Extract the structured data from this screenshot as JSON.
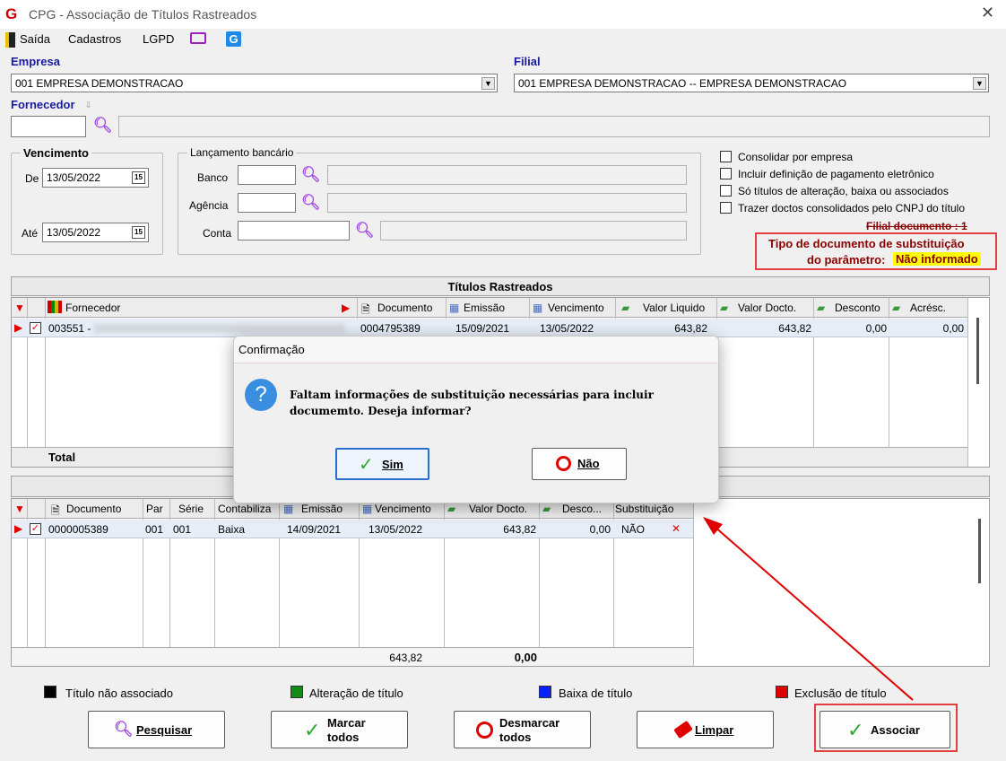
{
  "window": {
    "title": "CPG - Associação de Títulos Rastreados"
  },
  "menu": [
    "Saída",
    "Cadastros",
    "LGPD"
  ],
  "empresa": {
    "label": "Empresa",
    "value": "001 EMPRESA DEMONSTRACAO"
  },
  "filial": {
    "label": "Filial",
    "value": "001 EMPRESA DEMONSTRACAO -- EMPRESA DEMONSTRACAO"
  },
  "fornecedor": {
    "label": "Fornecedor"
  },
  "vencimento": {
    "label": "Vencimento",
    "de_label": "De",
    "de": "13/05/2022",
    "ate_label": "Até",
    "ate": "13/05/2022"
  },
  "lancamento": {
    "label": "Lançamento bancário",
    "banco": "Banco",
    "agencia": "Agência",
    "conta": "Conta"
  },
  "options": [
    "Consolidar por empresa",
    "Incluir definição de pagamento eletrônico",
    "Só títulos de alteração, baixa ou associados",
    "Trazer doctos consolidados pelo CNPJ do título"
  ],
  "info": {
    "filial_doc": "Filial documento : 1",
    "tipo_line1": "Tipo de documento de substituição",
    "tipo_line2": "do parâmetro:",
    "tipo_value": "Não informado"
  },
  "grid1": {
    "title": "Títulos Rastreados",
    "cols": [
      "Fornecedor",
      "Documento",
      "Emissão",
      "Vencimento",
      "Valor Liquido",
      "Valor Docto.",
      "Desconto",
      "Acrésc."
    ],
    "row": {
      "fornecedor": "003551 -",
      "documento": "0004795389",
      "emissao": "15/09/2021",
      "vencimento": "13/05/2022",
      "liquido": "643,82",
      "docto": "643,82",
      "desconto": "0,00",
      "acresc": "0,00"
    },
    "total": "Total"
  },
  "grid2": {
    "cols": [
      "Documento",
      "Par",
      "Série",
      "Contabiliza",
      "Emissão",
      "Vencimento",
      "Valor Docto.",
      "Desco...",
      "Substituição"
    ],
    "row": {
      "documento": "0000005389",
      "par": "001",
      "serie": "001",
      "contabiliza": "Baixa",
      "emissao": "14/09/2021",
      "vencimento": "13/05/2022",
      "docto": "643,82",
      "desconto": "0,00",
      "subst": "NÃO"
    },
    "total_docto": "643,82",
    "total_desc": "0,00"
  },
  "legend": [
    "Título não associado",
    "Alteração de título",
    "Baixa de título",
    "Exclusão de título"
  ],
  "legend_colors": [
    "#000000",
    "#138a13",
    "#0a20ff",
    "#e00000"
  ],
  "buttons": {
    "pesquisar": "Pesquisar",
    "marcar1": "Marcar",
    "marcar2": "todos",
    "desmarcar1": "Desmarcar",
    "desmarcar2": "todos",
    "limpar": "Limpar",
    "associar": "Associar"
  },
  "dialog": {
    "title": "Confirmação",
    "message1": "Faltam informações de substituição necessárias para incluir",
    "message2": "documemto. Deseja informar?",
    "sim": "Sim",
    "nao": "Não"
  }
}
